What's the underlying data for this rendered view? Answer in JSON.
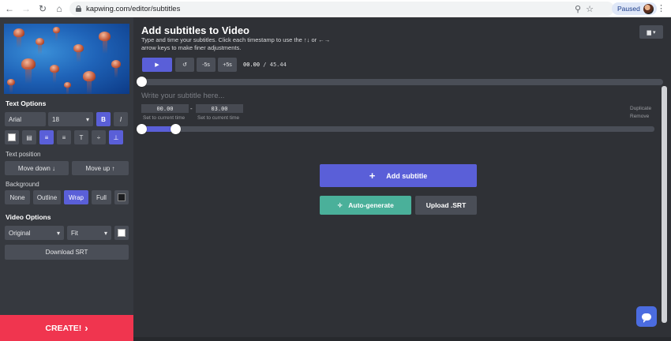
{
  "browser": {
    "url": "kapwing.com/editor/subtitles",
    "paused_label": "Paused",
    "back_icon": "arrow-left-icon",
    "forward_icon": "arrow-right-icon",
    "reload_icon": "reload-icon",
    "home_icon": "home-icon"
  },
  "sidebar": {
    "text_options_title": "Text Options",
    "font": "Arial",
    "size": "18",
    "bold_label": "B",
    "italic_label": "I",
    "align_buttons": [
      "▤",
      "≡",
      "≡",
      "T",
      "÷",
      "⊥"
    ],
    "text_position_title": "Text position",
    "move_down_label": "Move down ↓",
    "move_up_label": "Move up ↑",
    "background_title": "Background",
    "bg_none": "None",
    "bg_outline": "Outline",
    "bg_wrap": "Wrap",
    "bg_full": "Full",
    "video_options_title": "Video Options",
    "ratio": "Original",
    "fit": "Fit",
    "download_srt_label": "Download SRT",
    "create_label": "CREATE!"
  },
  "main": {
    "title": "Add subtitles to Video",
    "description": "Type and time your subtitles. Click each timestamp to use the ↑↓ or ←→ arrow keys to make finer adjustments.",
    "play_label": "▶",
    "reset_label": "↺",
    "back5_label": "-5s",
    "fwd5_label": "+5s",
    "current_time": "00.00",
    "time_sep": "/",
    "total_time": "45.44",
    "subtitle_placeholder": "Write your subtitle here...",
    "start_time": "00.00",
    "dash": "-",
    "end_time": "03.00",
    "set_current_1": "Set to current time",
    "set_current_2": "Set to current time",
    "duplicate_label": "Duplicate",
    "remove_label": "Remove",
    "add_subtitle_label": "Add subtitle",
    "auto_generate_label": "Auto-generate",
    "upload_srt_label": "Upload .SRT"
  },
  "colors": {
    "accent": "#5a5fd8",
    "create": "#f0354f",
    "auto_generate": "#4ab09a",
    "panel": "#36393f",
    "background": "#2f3136"
  }
}
